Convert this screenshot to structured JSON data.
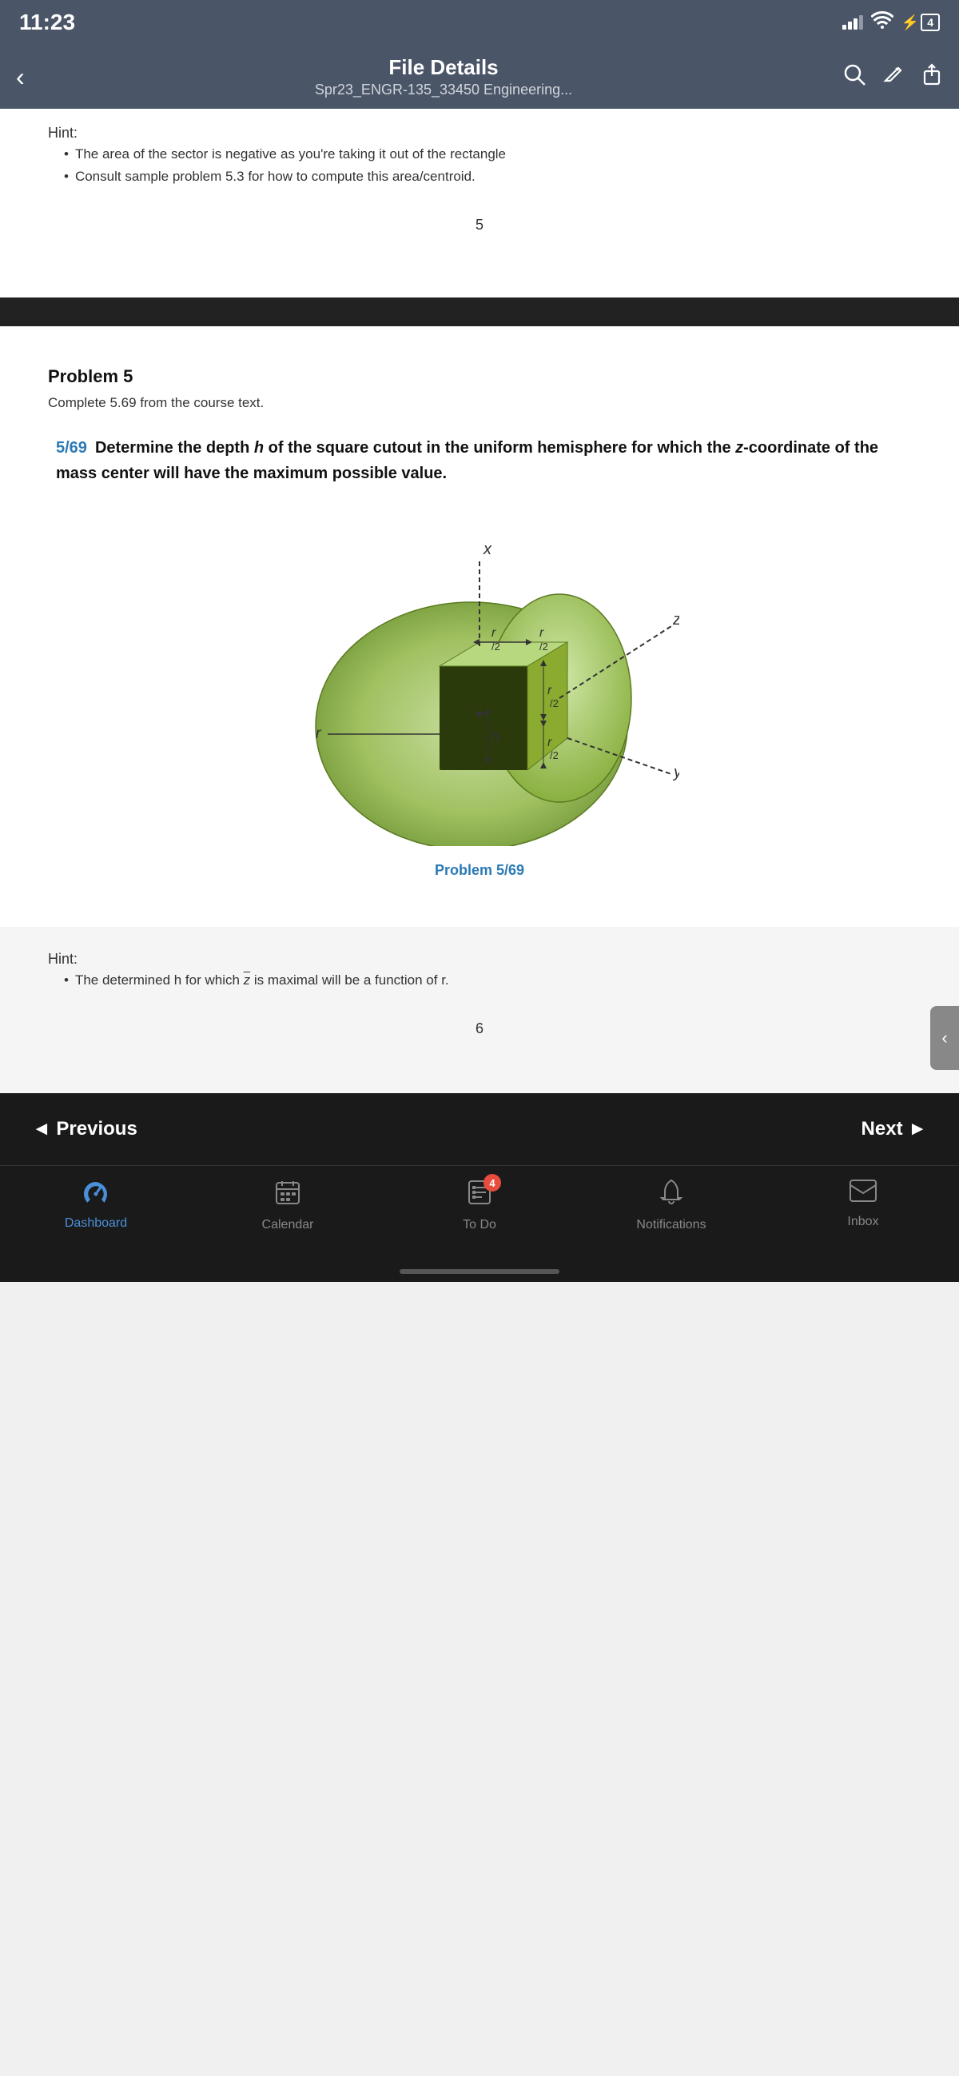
{
  "status": {
    "time": "11:23",
    "signal_bars": [
      4,
      8,
      12,
      16
    ],
    "wifi": "wifi",
    "battery": "⚡4"
  },
  "header": {
    "back_label": "‹",
    "title": "File Details",
    "subtitle": "Spr23_ENGR-135_33450 Engineering...",
    "search_icon": "search",
    "edit_icon": "edit",
    "share_icon": "share"
  },
  "page5": {
    "hint_label": "Hint:",
    "bullets": [
      "The area of the sector is negative as you're taking it out of the rectangle",
      "Consult sample problem 5.3 for how to compute this area/centroid."
    ],
    "page_number": "5"
  },
  "page6": {
    "problem_title": "Problem 5",
    "problem_desc": "Complete 5.69 from the course text.",
    "problem_number_label": "5/69",
    "problem_text": "Determine the depth h of the square cutout in the uniform hemisphere for which the z-coordinate of the mass center will have the maximum possible value.",
    "figure_caption": "Problem 5/69",
    "hint_label": "Hint:",
    "hint_bullets": [
      "The determined h for which z̄ is maximal will be a function of r."
    ],
    "page_number": "6"
  },
  "nav": {
    "prev_label": "◄ Previous",
    "next_label": "Next ►"
  },
  "tabs": [
    {
      "id": "dashboard",
      "label": "Dashboard",
      "icon": "dashboard",
      "active": true,
      "badge": null
    },
    {
      "id": "calendar",
      "label": "Calendar",
      "icon": "calendar",
      "active": false,
      "badge": null
    },
    {
      "id": "todo",
      "label": "To Do",
      "icon": "todo",
      "active": false,
      "badge": "4"
    },
    {
      "id": "notifications",
      "label": "Notifications",
      "icon": "notifications",
      "active": false,
      "badge": null
    },
    {
      "id": "inbox",
      "label": "Inbox",
      "icon": "inbox",
      "active": false,
      "badge": null
    }
  ],
  "pull_tab": {
    "icon": "‹"
  }
}
